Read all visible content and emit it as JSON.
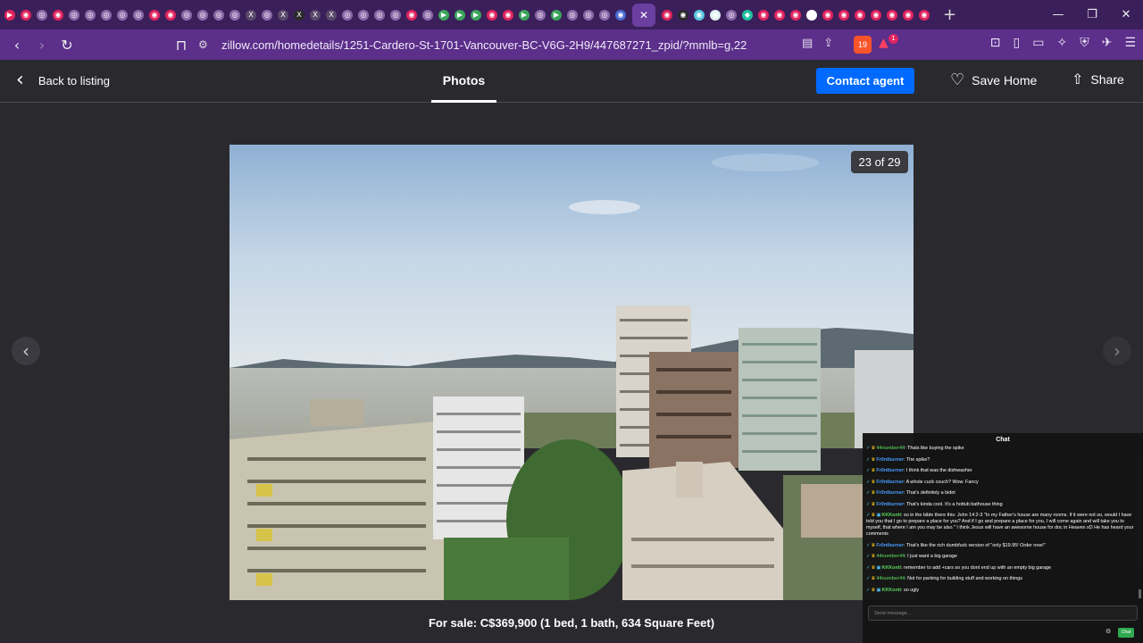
{
  "browser": {
    "tabs": [
      {
        "color": "#e0245e",
        "glyph": "▶"
      },
      {
        "color": "#e0245e",
        "glyph": "◉"
      },
      {
        "color": "#8a6aa8",
        "glyph": "◎"
      },
      {
        "color": "#e0245e",
        "glyph": "◉"
      },
      {
        "color": "#8a6aa8",
        "glyph": "◎"
      },
      {
        "color": "#8a6aa8",
        "glyph": "◎"
      },
      {
        "color": "#8a6aa8",
        "glyph": "◎"
      },
      {
        "color": "#8a6aa8",
        "glyph": "◎"
      },
      {
        "color": "#8a6aa8",
        "glyph": "◎"
      },
      {
        "color": "#e0245e",
        "glyph": "◉"
      },
      {
        "color": "#e0245e",
        "glyph": "◉"
      },
      {
        "color": "#8a6aa8",
        "glyph": "◎"
      },
      {
        "color": "#8a6aa8",
        "glyph": "◎"
      },
      {
        "color": "#8a6aa8",
        "glyph": "◎"
      },
      {
        "color": "#8a6aa8",
        "glyph": "◎"
      },
      {
        "color": "#5a4a6a",
        "glyph": "X"
      },
      {
        "color": "#8a6aa8",
        "glyph": "◎"
      },
      {
        "color": "#5a4a6a",
        "glyph": "X"
      },
      {
        "color": "#2a2a2a",
        "glyph": "X"
      },
      {
        "color": "#5a4a6a",
        "glyph": "X"
      },
      {
        "color": "#5a4a6a",
        "glyph": "X"
      },
      {
        "color": "#8a6aa8",
        "glyph": "◎"
      },
      {
        "color": "#8a6aa8",
        "glyph": "◎"
      },
      {
        "color": "#8a6aa8",
        "glyph": "◎"
      },
      {
        "color": "#8a6aa8",
        "glyph": "◎"
      },
      {
        "color": "#e0245e",
        "glyph": "◉"
      },
      {
        "color": "#8a6aa8",
        "glyph": "◎"
      },
      {
        "color": "#3ba55c",
        "glyph": "▶"
      },
      {
        "color": "#3ba55c",
        "glyph": "▶"
      },
      {
        "color": "#3ba55c",
        "glyph": "▶"
      },
      {
        "color": "#e0245e",
        "glyph": "◉"
      },
      {
        "color": "#e0245e",
        "glyph": "◉"
      },
      {
        "color": "#3ba55c",
        "glyph": "▶"
      },
      {
        "color": "#8a6aa8",
        "glyph": "◎"
      },
      {
        "color": "#3ba55c",
        "glyph": "▶"
      },
      {
        "color": "#8a6aa8",
        "glyph": "◎"
      },
      {
        "color": "#8a6aa8",
        "glyph": "◎"
      },
      {
        "color": "#8a6aa8",
        "glyph": "◎"
      },
      {
        "color": "#4a6ad0",
        "glyph": "◉"
      }
    ],
    "active_tab_glyph": "✕",
    "tabs_after": [
      {
        "color": "#e0245e",
        "glyph": "◉"
      },
      {
        "color": "#2a2a2a",
        "glyph": "◉"
      },
      {
        "color": "#5ac8e0",
        "glyph": "◉"
      },
      {
        "color": "#e0f0f0",
        "glyph": "◉"
      },
      {
        "color": "#8a6aa8",
        "glyph": "◎"
      },
      {
        "color": "#20c0a0",
        "glyph": "◆"
      },
      {
        "color": "#e0245e",
        "glyph": "◉"
      },
      {
        "color": "#e0245e",
        "glyph": "◉"
      },
      {
        "color": "#e0245e",
        "glyph": "◉"
      },
      {
        "color": "#ffffff",
        "glyph": "G"
      },
      {
        "color": "#e0245e",
        "glyph": "◉"
      },
      {
        "color": "#e0245e",
        "glyph": "◉"
      },
      {
        "color": "#e0245e",
        "glyph": "◉"
      },
      {
        "color": "#e0245e",
        "glyph": "◉"
      },
      {
        "color": "#e0245e",
        "glyph": "◉"
      },
      {
        "color": "#e0245e",
        "glyph": "◉"
      },
      {
        "color": "#e0245e",
        "glyph": "◉"
      }
    ],
    "new_tab": "+",
    "url": "zillow.com/homedetails/1251-Cardero-St-1701-Vancouver-BC-V6G-2H9/447687271_zpid/?mmlb=g,22",
    "brave_count": "19",
    "alert_count": "1"
  },
  "header": {
    "back_label": "Back to listing",
    "tab_label": "Photos",
    "contact_label": "Contact agent",
    "save_label": "Save Home",
    "share_label": "Share"
  },
  "viewer": {
    "counter": "23 of 29",
    "caption": "For sale: C$369,900 (1 bed, 1 bath, 634 Square Feet)"
  },
  "chat": {
    "title": "Chat",
    "messages": [
      {
        "user": "44number44",
        "color": "#4caf50",
        "text": ": Thats like buying the spike",
        "mod": false
      },
      {
        "user": "Fr0ntburner",
        "color": "#4a9cff",
        "text": ": The spike?",
        "mod": false
      },
      {
        "user": "Fr0ntburner",
        "color": "#4a9cff",
        "text": ": I think that was the dishwasher",
        "mod": false
      },
      {
        "user": "Fr0ntburner",
        "color": "#4a9cff",
        "text": ": A whole cuck couch? Wow. Fancy",
        "mod": false
      },
      {
        "user": "Fr0ntburner",
        "color": "#4a9cff",
        "text": ": That's definitely a bidet",
        "mod": false
      },
      {
        "user": "Fr0ntburner",
        "color": "#4a9cff",
        "text": ": That's kinda cool. It's a hottub bathouse thing",
        "mod": false
      },
      {
        "user": "KKKonti",
        "color": "#5dd55d",
        "text": ": so in the bible there this: John 14:2-3 \"In my Father's house are many rooms. If it were not so, would I have told you that I go to prepare a place for you? And if I go and prepare a place for you, I will come again and will take you to myself, that where I am you may be also.\" I think Jesus will have an awesome house for doc in Heaven xD He has heard your comments",
        "mod": true
      },
      {
        "user": "Fr0ntburner",
        "color": "#4a9cff",
        "text": ": That's like the rich dumbfuck version of \"only $19.95! Order now!\"",
        "mod": false
      },
      {
        "user": "44number44",
        "color": "#4caf50",
        "text": ": I just want a big garage",
        "mod": false
      },
      {
        "user": "KKKonti",
        "color": "#5dd55d",
        "text": ": remember to add +cars so you dont end up with an empty big garage",
        "mod": true
      },
      {
        "user": "44number44",
        "color": "#4caf50",
        "text": ": Not for parking for building stuff and working on things",
        "mod": false
      },
      {
        "user": "KKKonti",
        "color": "#5dd55d",
        "text": ": so ugly",
        "mod": true
      }
    ],
    "input_placeholder": "Send message...",
    "send_label": "Chat"
  }
}
